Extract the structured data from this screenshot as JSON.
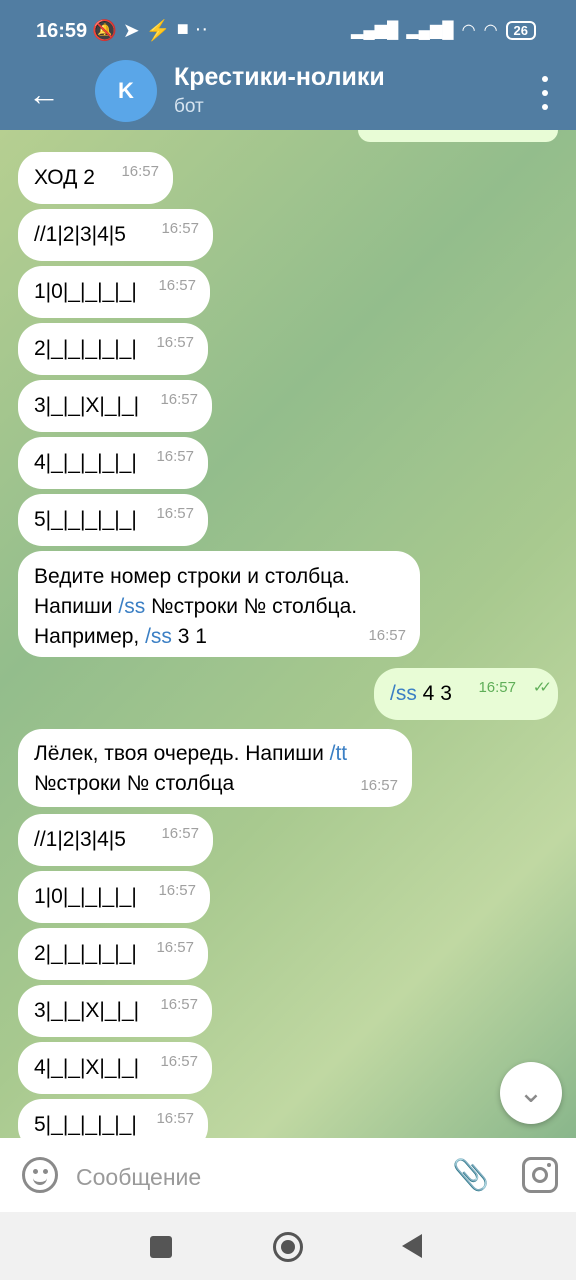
{
  "status_bar": {
    "time": "16:59",
    "left_icons": [
      "mute-icon",
      "telegram-icon",
      "app-icon",
      "square-icon",
      "dots-icon"
    ],
    "battery": "26"
  },
  "header": {
    "avatar_letter": "K",
    "title": "Крестики-нолики",
    "subtitle": "бот"
  },
  "messages": [
    {
      "text": "ХОД 2",
      "time": "16:57"
    },
    {
      "text": "//1|2|3|4|5",
      "time": "16:57"
    },
    {
      "text": "1|0|_|_|_|_|",
      "time": "16:57"
    },
    {
      "text": "2|_|_|_|_|_|",
      "time": "16:57"
    },
    {
      "text": "3|_|_|X|_|_|",
      "time": "16:57"
    },
    {
      "text": "4|_|_|_|_|_|",
      "time": "16:57"
    },
    {
      "text": "5|_|_|_|_|_|",
      "time": "16:57"
    },
    {
      "line1": "Ведите номер строки и столбца.",
      "line2_pre": "Напиши ",
      "line2_cmd": "/ss",
      "line2_post": " №строки № столбца.",
      "line3_pre": "Например, ",
      "line3_cmd": "/ss",
      "line3_post": " 3 1",
      "time": "16:57"
    },
    {
      "cmd": "/ss",
      "text": " 4 3",
      "time": "16:57",
      "outgoing": true
    },
    {
      "line1_pre": "Лёлек, твоя очередь. Напиши ",
      "line1_cmd": "/tt",
      "line2": "№строки № столбца",
      "time": "16:57"
    },
    {
      "text": "//1|2|3|4|5",
      "time": "16:57"
    },
    {
      "text": "1|0|_|_|_|_|",
      "time": "16:57"
    },
    {
      "text": "2|_|_|_|_|_|",
      "time": "16:57"
    },
    {
      "text": "3|_|_|X|_|_|",
      "time": "16:57"
    },
    {
      "text": "4|_|_|X|_|_|",
      "time": "16:57"
    },
    {
      "text": "5|_|_|_|_|_|",
      "time": "16:57"
    }
  ],
  "input": {
    "placeholder": "Сообщение"
  }
}
